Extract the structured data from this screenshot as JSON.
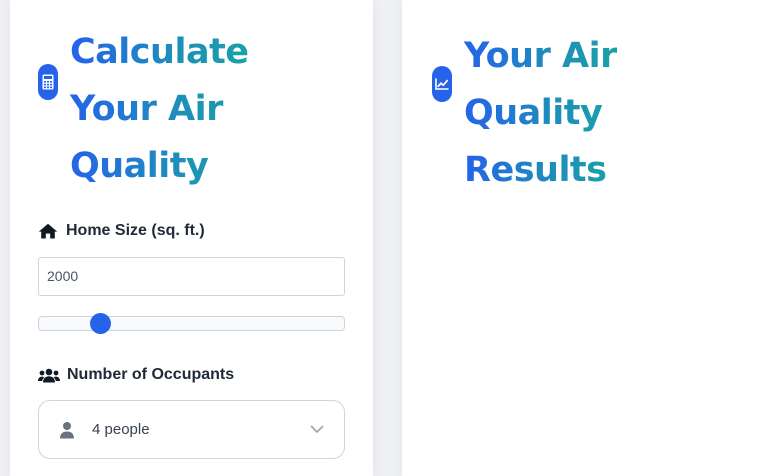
{
  "calculator": {
    "heading_lines": [
      "Calculate",
      "Your Air",
      "Quality"
    ],
    "icon": "calculator-icon",
    "home_size": {
      "label": "Home Size (sq. ft.)",
      "icon": "house-icon",
      "value": "2000",
      "slider_fraction": 0.2
    },
    "occupants": {
      "label": "Number of Occupants",
      "icon": "users-icon",
      "selected": "4 people",
      "option_icon": "user-icon",
      "dropdown_icon": "chevron-down-icon"
    }
  },
  "results": {
    "heading_lines": [
      "Your Air",
      "Quality",
      "Results"
    ],
    "icon": "chart-line-icon"
  },
  "colors": {
    "accent": "#2563eb",
    "heading_gradient_end": "#17a2a8",
    "label_text": "#1f2937"
  }
}
